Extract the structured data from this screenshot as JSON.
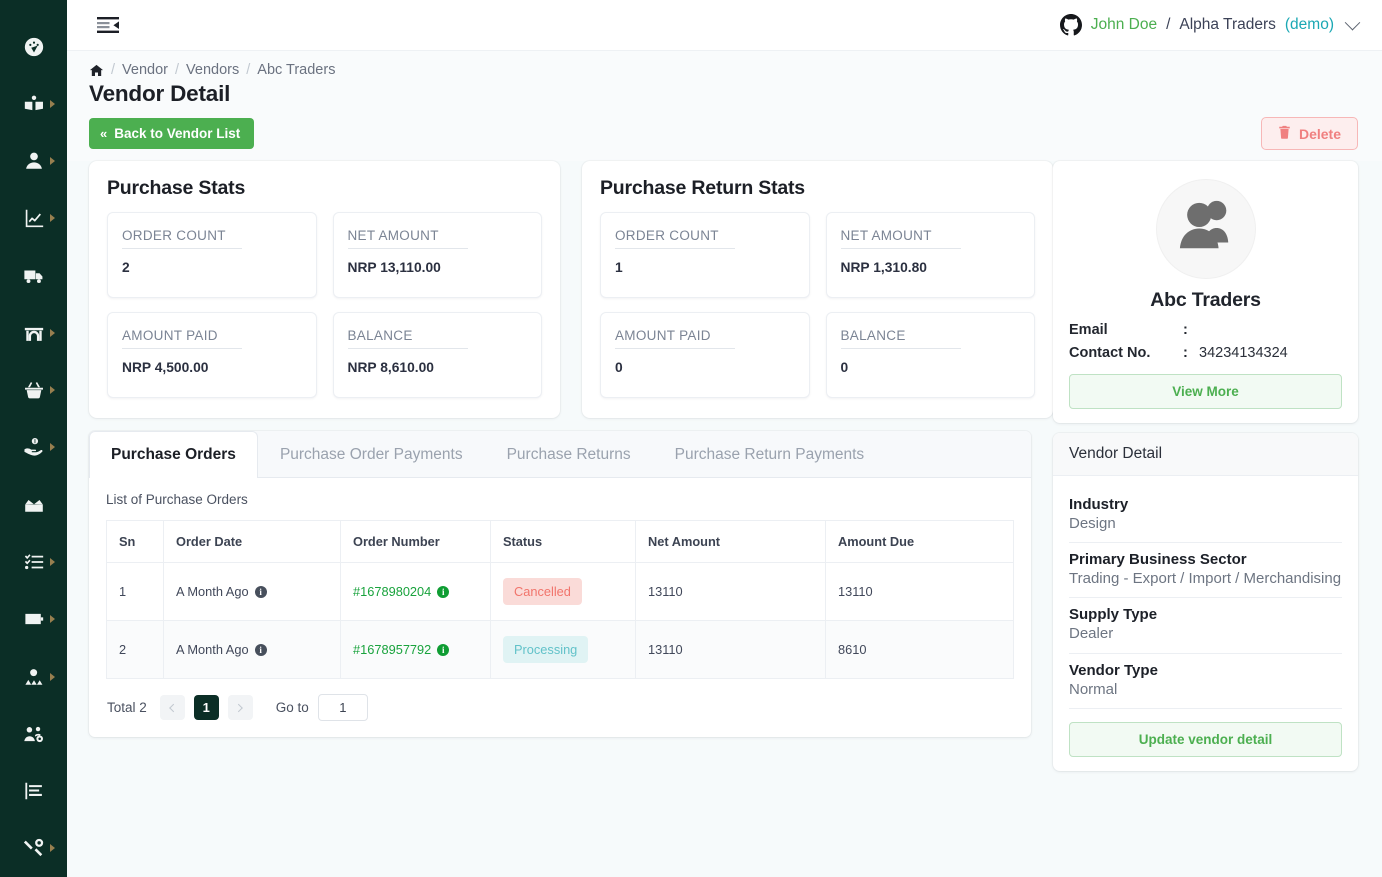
{
  "rail": {
    "items": [
      {
        "name": "dashboard",
        "icon": "gauge-icon",
        "has_caret": false
      },
      {
        "name": "catalog",
        "icon": "open-book-icon",
        "has_caret": true
      },
      {
        "name": "customers",
        "icon": "user-icon",
        "has_caret": true
      },
      {
        "name": "reports",
        "icon": "line-chart-icon",
        "has_caret": true
      },
      {
        "name": "shipping",
        "icon": "truck-icon",
        "has_caret": false
      },
      {
        "name": "warehouse",
        "icon": "store-icon",
        "has_caret": true
      },
      {
        "name": "sales",
        "icon": "basket-icon",
        "has_caret": true
      },
      {
        "name": "payments",
        "icon": "hand-money-icon",
        "has_caret": true
      },
      {
        "name": "inventory",
        "icon": "open-box-icon",
        "has_caret": false
      },
      {
        "name": "tasks",
        "icon": "checklist-icon",
        "has_caret": true
      },
      {
        "name": "wallet",
        "icon": "wallet-icon",
        "has_caret": true
      },
      {
        "name": "vendors",
        "icon": "person-group-icon",
        "has_caret": true
      },
      {
        "name": "team",
        "icon": "users-gear-icon",
        "has_caret": false
      },
      {
        "name": "analytics",
        "icon": "bar-chart-icon",
        "has_caret": false
      },
      {
        "name": "tools",
        "icon": "tools-icon",
        "has_caret": true
      }
    ]
  },
  "topbar": {
    "menu_toggle": "menu-fold-icon",
    "account_icon": "github-icon",
    "user_name": "John Doe",
    "separator": "/",
    "org_name": "Alpha Traders",
    "demo_tag": "(demo)"
  },
  "breadcrumb": {
    "home_icon": "home-icon",
    "separator": "/",
    "items": [
      "Vendor",
      "Vendors",
      "Abc Traders"
    ]
  },
  "page": {
    "title": "Vendor Detail",
    "back_button": "Back to Vendor List",
    "delete_button": "Delete"
  },
  "purchase_stats": {
    "title": "Purchase Stats",
    "tiles": [
      {
        "label": "ORDER COUNT",
        "value": "2"
      },
      {
        "label": "NET AMOUNT",
        "value": "NRP 13,110.00"
      },
      {
        "label": "AMOUNT PAID",
        "value": "NRP 4,500.00"
      },
      {
        "label": "BALANCE",
        "value": "NRP 8,610.00"
      }
    ]
  },
  "purchase_return_stats": {
    "title": "Purchase Return Stats",
    "tiles": [
      {
        "label": "ORDER COUNT",
        "value": "1"
      },
      {
        "label": "NET AMOUNT",
        "value": "NRP 1,310.80"
      },
      {
        "label": "AMOUNT PAID",
        "value": "0"
      },
      {
        "label": "BALANCE",
        "value": "0"
      }
    ]
  },
  "tabs": [
    {
      "label": "Purchase Orders",
      "active": true
    },
    {
      "label": "Purchase Order Payments",
      "active": false
    },
    {
      "label": "Purchase Returns",
      "active": false
    },
    {
      "label": "Purchase Return Payments",
      "active": false
    }
  ],
  "table": {
    "caption": "List of Purchase Orders",
    "columns": [
      "Sn",
      "Order Date",
      "Order Number",
      "Status",
      "Net Amount",
      "Amount Due"
    ],
    "rows": [
      {
        "sn": "1",
        "order_date": "A Month Ago",
        "order_number": "#1678980204",
        "status": "Cancelled",
        "status_kind": "cancelled",
        "net_amount": "13110",
        "amount_due": "13110"
      },
      {
        "sn": "2",
        "order_date": "A Month Ago",
        "order_number": "#1678957792",
        "status": "Processing",
        "status_kind": "processing",
        "net_amount": "13110",
        "amount_due": "8610"
      }
    ]
  },
  "pagination": {
    "total_label": "Total 2",
    "prev_icon": "chevron-left-icon",
    "next_icon": "chevron-right-icon",
    "current_page": "1",
    "goto_label": "Go to",
    "goto_value": "1"
  },
  "vendor_card": {
    "avatar_icon": "people-avatar-icon",
    "name": "Abc Traders",
    "email_label": "Email",
    "email_colon": ":",
    "email_value": "",
    "contact_label": "Contact No.",
    "contact_colon": ":",
    "contact_value": "34234134324",
    "view_more": "View More"
  },
  "vendor_detail": {
    "header": "Vendor Detail",
    "fields": [
      {
        "key": "Industry",
        "value": "Design"
      },
      {
        "key": "Primary Business Sector",
        "value": "Trading - Export / Import / Merchandising"
      },
      {
        "key": "Supply Type",
        "value": "Dealer"
      },
      {
        "key": "Vendor Type",
        "value": "Normal"
      }
    ],
    "update_button": "Update vendor detail"
  },
  "colors": {
    "rail_bg": "#0b2e26",
    "brand_green": "#4caf50",
    "link_green": "#19a33d",
    "danger": "#f08080",
    "badge_cancelled_bg": "#fadbd8",
    "badge_cancelled_fg": "#f1756c",
    "badge_processing_bg": "#e0f3f4",
    "badge_processing_fg": "#62c2c9",
    "demo_tag": "#1ba8b4",
    "page_bg": "#f6fafb"
  }
}
